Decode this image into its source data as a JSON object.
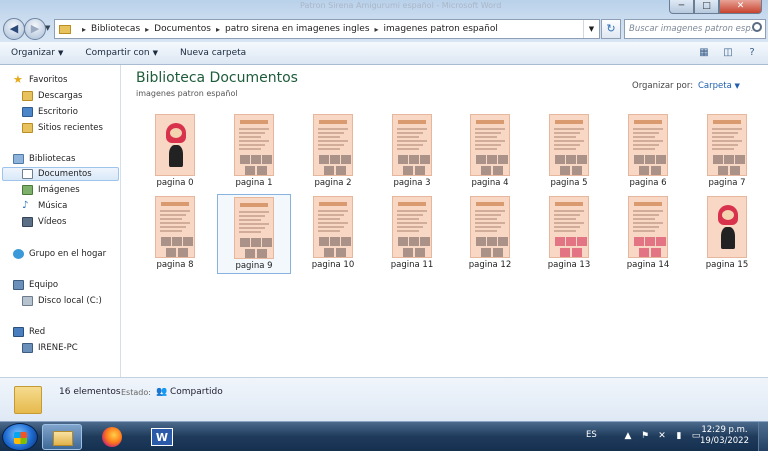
{
  "window": {
    "title": "Patron Sirena Amigurumi español - Microsoft Word",
    "minimize": "─",
    "maximize": "□",
    "close": "✕"
  },
  "address": {
    "crumbs": [
      "Bibliotecas",
      "Documentos",
      "patro sirena en imagenes ingles",
      "imagenes patron español"
    ],
    "search_placeholder": "Buscar imagenes patron esp..."
  },
  "toolbar": {
    "organize": "Organizar",
    "share": "Compartir con",
    "new_folder": "Nueva carpeta"
  },
  "sidebar": {
    "favorites": "Favoritos",
    "downloads": "Descargas",
    "desktop": "Escritorio",
    "recent": "Sitios recientes",
    "libraries": "Bibliotecas",
    "documents": "Documentos",
    "images": "Imágenes",
    "music": "Música",
    "videos": "Vídeos",
    "homegroup": "Grupo en el hogar",
    "computer": "Equipo",
    "local_disk": "Disco local (C:)",
    "network": "Red",
    "pc": "IRENE-PC"
  },
  "content": {
    "title": "Biblioteca Documentos",
    "subtitle": "imagenes patron español",
    "organize_by_label": "Organizar por:",
    "organize_by_value": "Carpeta",
    "files": [
      "pagina 0",
      "pagina 1",
      "pagina 2",
      "pagina 3",
      "pagina 4",
      "pagina 5",
      "pagina 6",
      "pagina 7",
      "pagina 8",
      "pagina 9",
      "pagina 10",
      "pagina 11",
      "pagina 12",
      "pagina 13",
      "pagina 14",
      "pagina 15"
    ],
    "selected_index": 9
  },
  "details": {
    "count": "16 elementos",
    "state_label": "Estado:",
    "state_value": "Compartido"
  },
  "taskbar": {
    "lang": "ES",
    "time": "12:29 p.m.",
    "date": "19/03/2022"
  }
}
